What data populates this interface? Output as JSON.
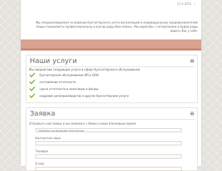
{
  "header": {
    "date": "11.4.2011",
    "date_separator": "|"
  },
  "intro": {
    "line1": "Мы специализируемся на ведении бухгалтерского учета организаций и индивидуальных предпринимателей",
    "line2": "Наши специалисты профессиональны и всегда рады Вам помочь. Мы ждем Вас с нетерпением и будем рады видеть Вас у себя."
  },
  "services": {
    "title": "Наши услуги",
    "lead": "Мы предлагаем следующие услуги в сфере бухгалтерского обслуживания:",
    "items": [
      "Бухгалтерское обслуживание ИП и ООО",
      "составление отчетности",
      "сдача отчетности в налоговую и фонды",
      "кадровое делопроизводство и другие бухгалтерские услуги"
    ]
  },
  "order": {
    "title": "Заявка",
    "lead": "Отправьте нам заявку и мы свяжемся с Вами в самое ближайшее время",
    "fields": [
      {
        "placeholder": "Название организации (полностью)"
      },
      {
        "label": "Контактное лицо",
        "placeholder": ""
      },
      {
        "label": "Телефон",
        "placeholder": ""
      },
      {
        "label": "E-mail",
        "placeholder": ""
      }
    ]
  },
  "colors": {
    "band": "#d9a291",
    "band_dark": "#c58874",
    "check": "#8ab446"
  },
  "icons": {
    "print": "print-icon",
    "check": "check-icon"
  }
}
